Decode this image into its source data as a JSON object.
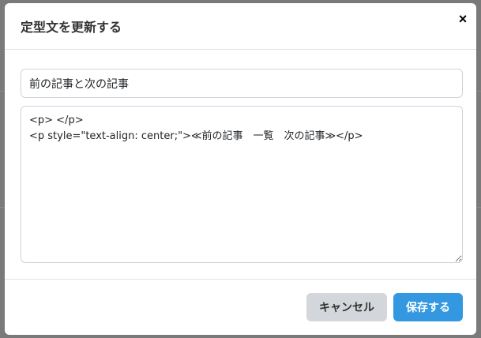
{
  "dialog": {
    "title": "定型文を更新する",
    "close_label": "×"
  },
  "form": {
    "title_value": "前の記事と次の記事",
    "content_value": "<p> </p>\n<p style=\"text-align: center;\">≪前の記事　一覧　次の記事≫</p>"
  },
  "footer": {
    "cancel_label": "キャンセル",
    "save_label": "保存する"
  },
  "colors": {
    "primary": "#3498e0",
    "secondary": "#d3d6da"
  }
}
